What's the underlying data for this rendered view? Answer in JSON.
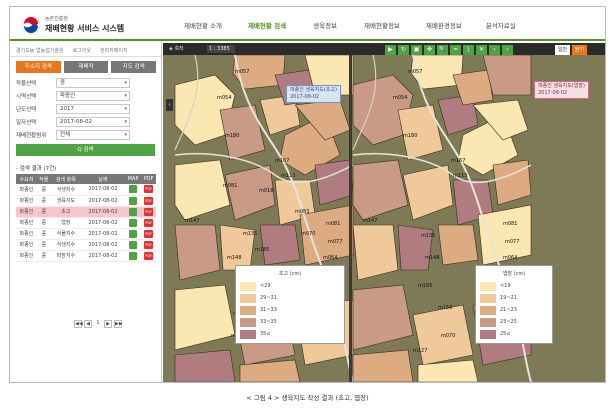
{
  "header": {
    "logo_sub": "농촌진흥청",
    "title": "재배현황 서비스 시스템",
    "nav": [
      "재배현황 소개",
      "재배현황 검색",
      "생육정보",
      "재배현황정보",
      "재배환경정보",
      "분석자료실"
    ],
    "active_nav": 1
  },
  "sidebar": {
    "topline": [
      "경기도농 업농업기술원",
      "로그아웃",
      "관리자페이지"
    ],
    "tabs": [
      "주소지 검색",
      "재배작",
      "지도 검색"
    ],
    "filters": [
      {
        "label": "작물선택",
        "value": "콩"
      },
      {
        "label": "시역선택",
        "value": "파종인"
      },
      {
        "label": "년도선택",
        "value": "2017"
      },
      {
        "label": "일자선택",
        "value": "2017-08-02"
      },
      {
        "label": "재배현황범위",
        "value": "전체"
      }
    ],
    "search_label": "Q 검색",
    "result_title": "- 검색 결과 (7건)",
    "columns": [
      "수요처",
      "작물",
      "검색 항목",
      "날짜",
      "MAP",
      "PDF"
    ],
    "rows": [
      [
        "파종인",
        "콩",
        "식생지수",
        "2017-08-02"
      ],
      [
        "파종인",
        "콩",
        "생육지도",
        "2017-08-02"
      ],
      [
        "파종인",
        "콩",
        "초고",
        "2017-08-02"
      ],
      [
        "파종인",
        "콩",
        "엽장",
        "2017-08-02"
      ],
      [
        "파종인",
        "콩",
        "식물지수",
        "2017-08-02"
      ],
      [
        "파종인",
        "콩",
        "식생지수",
        "2017-08-02"
      ],
      [
        "파종인",
        "콩",
        "파장지수",
        "2017-08-02"
      ]
    ],
    "highlight_row": 2,
    "pdf_label": "PDF",
    "pager": [
      "◀◀",
      "◀",
      "1",
      "▶",
      "▶▶"
    ]
  },
  "map": {
    "scale_label": "축척",
    "scale_value": "1 : 3385",
    "tools": [
      "play-icon",
      "refresh-icon",
      "layers-icon",
      "move-icon",
      "zoom-icon",
      "measure-line-icon",
      "measure-area-icon",
      "close-icon",
      "prev-icon",
      "next-icon"
    ],
    "tool_glyphs": [
      "▶",
      "↻",
      "▣",
      "✥",
      "🔍",
      "━",
      "⌊",
      "✕",
      "‹",
      "›"
    ],
    "default_label": "일반",
    "close_label": "닫기",
    "left_popup": [
      "파종인 생육지도(초고)",
      "2017-08-02"
    ],
    "right_popup": [
      "파종인 생육지도(엽장)",
      "2017-08-02"
    ],
    "legend_left": {
      "title": "초고 (cm)",
      "items": [
        "<29",
        "29~31",
        "31~33",
        "33~35",
        "35≤"
      ],
      "colors": [
        "#fbe7b2",
        "#efc99a",
        "#ddab82",
        "#c99a86",
        "#b17c80"
      ]
    },
    "legend_right": {
      "title": "엽장 (cm)",
      "items": [
        "<19",
        "19~21",
        "21~23",
        "23~25",
        "25≤"
      ],
      "colors": [
        "#fbe7b2",
        "#efc99a",
        "#ddab82",
        "#c99a86",
        "#b17c80"
      ]
    },
    "labels_left": [
      "m057",
      "m054",
      "m180",
      "m167",
      "m147",
      "m135",
      "m113",
      "m018",
      "m148",
      "m070",
      "m185",
      "m118",
      "m127",
      "m081",
      "m077",
      "m064",
      "m201",
      "m065",
      "m159",
      "m083",
      "m081"
    ],
    "labels_right": [
      "m057",
      "m054",
      "m180",
      "m167",
      "m147",
      "m113",
      "m135",
      "m148",
      "m150",
      "m185",
      "m081",
      "m077",
      "m064",
      "m064",
      "m065",
      "m070",
      "m127",
      "m201"
    ]
  },
  "caption": "< 그림 4 > 생육지도 작성 결과 (초고, 엽장)"
}
